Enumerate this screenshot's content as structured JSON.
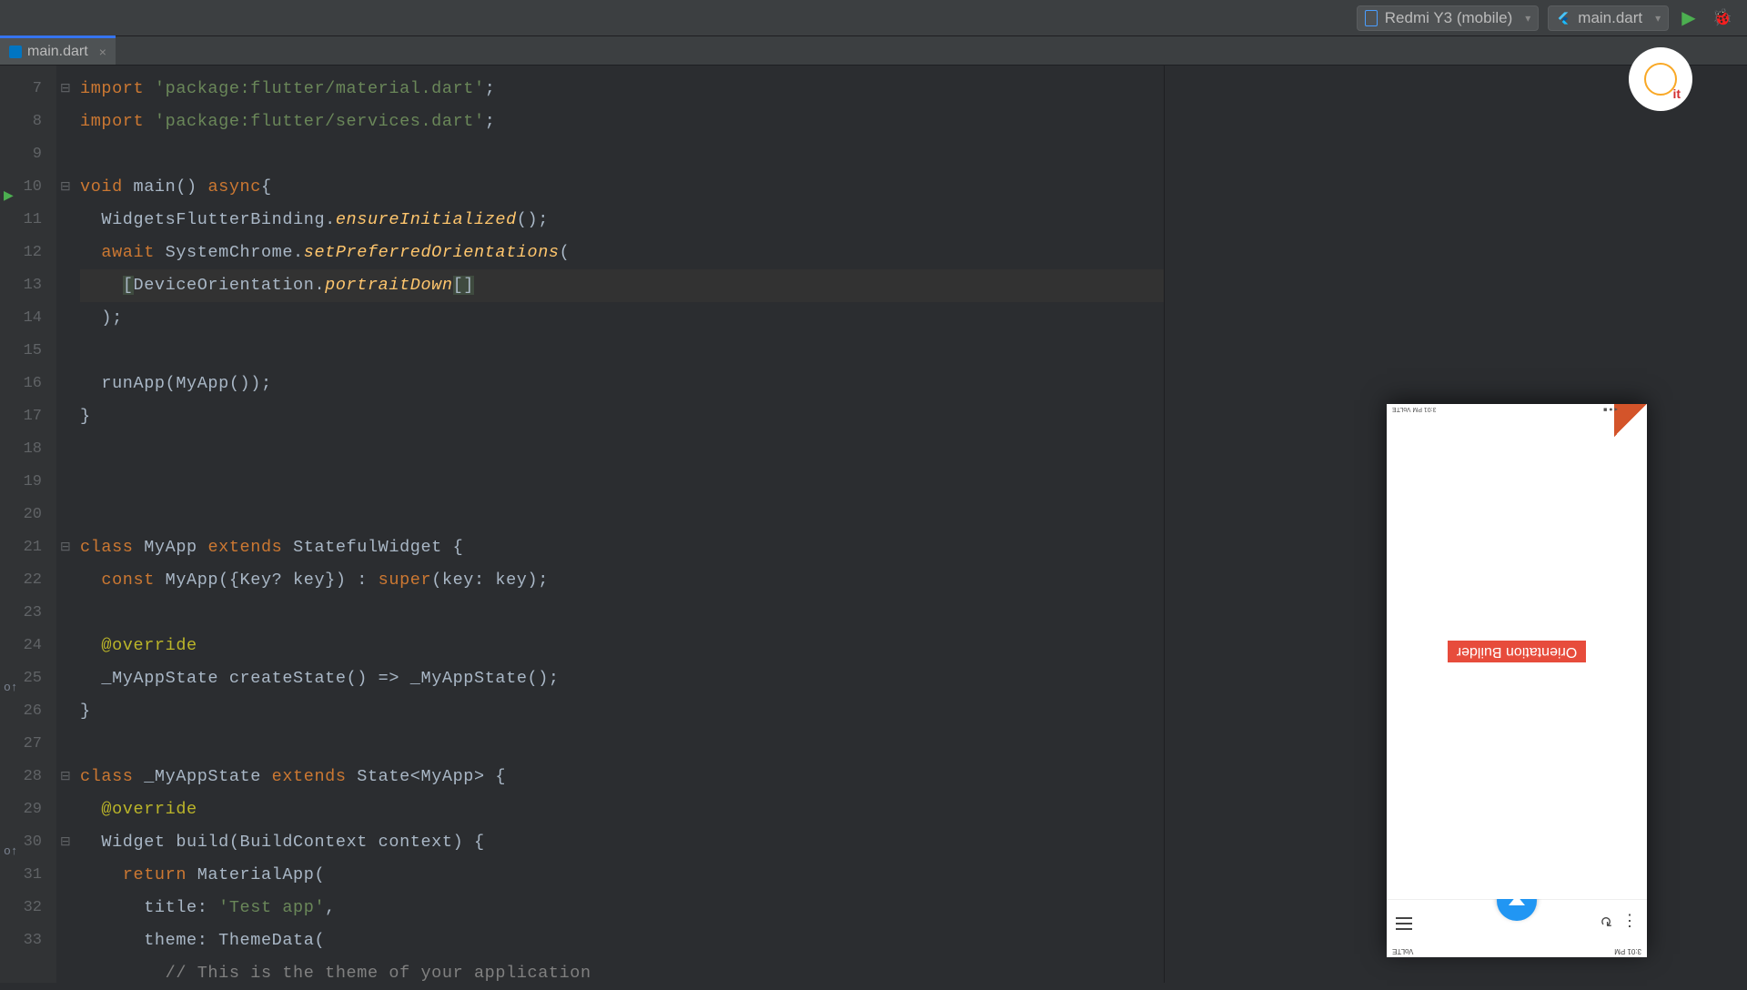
{
  "toolbar": {
    "device": "Redmi Y3 (mobile)",
    "config": "main.dart"
  },
  "tab": {
    "filename": "main.dart"
  },
  "gutter": {
    "lines": [
      7,
      8,
      9,
      10,
      11,
      12,
      13,
      14,
      15,
      16,
      17,
      18,
      19,
      20,
      21,
      22,
      23,
      24,
      25,
      26,
      27,
      28,
      29,
      30,
      31,
      32,
      33
    ]
  },
  "code": {
    "l7": {
      "kw": "import",
      "str": "'package:flutter/material.dart'",
      "semi": ";"
    },
    "l8": {
      "kw": "import",
      "str": "'package:flutter/services.dart'",
      "semi": ";"
    },
    "l10": {
      "void": "void",
      "main": "main",
      "parens": "()",
      "async": "async",
      "brace": "{"
    },
    "l11": {
      "cls": "WidgetsFlutterBinding",
      "dot": ".",
      "fn": "ensureInitialized",
      "end": "();"
    },
    "l12": {
      "await": "await",
      "cls": "SystemChrome",
      "dot": ".",
      "fn": "setPreferredOrientations",
      "paren": "("
    },
    "l13": {
      "lb": "[",
      "cls": "DeviceOrientation",
      "dot": ".",
      "fn": "portraitDown",
      "rb": "[]"
    },
    "l14": ");",
    "l16": {
      "fn": "runApp",
      "open": "(",
      "cls": "MyApp",
      "end": "());"
    },
    "l17": "}",
    "l21": {
      "class": "class",
      "name": "MyApp",
      "extends": "extends",
      "base": "StatefulWidget",
      "brace": " {"
    },
    "l22": {
      "const": "const",
      "name": "MyApp",
      "sig": "({Key? key}) :",
      "super": "super",
      "end": "(key: key);"
    },
    "l24": "@override",
    "l25": {
      "state": "_MyAppState",
      "fn": "createState",
      "arrow": "() =>",
      "state2": "_MyAppState",
      "end": "();"
    },
    "l26": "}",
    "l28": {
      "class": "class",
      "name": "_MyAppState",
      "extends": "extends",
      "base": "State<MyApp>",
      "brace": " {"
    },
    "l29": "@override",
    "l30": {
      "widget": "Widget",
      "fn": "build",
      "sig": "(BuildContext context)",
      "brace": " {"
    },
    "l31": {
      "return": "return",
      "cls": "MaterialApp",
      "paren": "("
    },
    "l32": {
      "key": "title:",
      "str": "'Test app'",
      "comma": ","
    },
    "l33": {
      "key": "theme:",
      "cls": "ThemeData",
      "paren": "("
    },
    "l34": "// This is the theme of your application"
  },
  "phone": {
    "body_text": "Orientation Builder",
    "status_left": "3:01 PM",
    "status_right": "VoLTE",
    "footer_right": "3:01 PM  VoLTE"
  }
}
